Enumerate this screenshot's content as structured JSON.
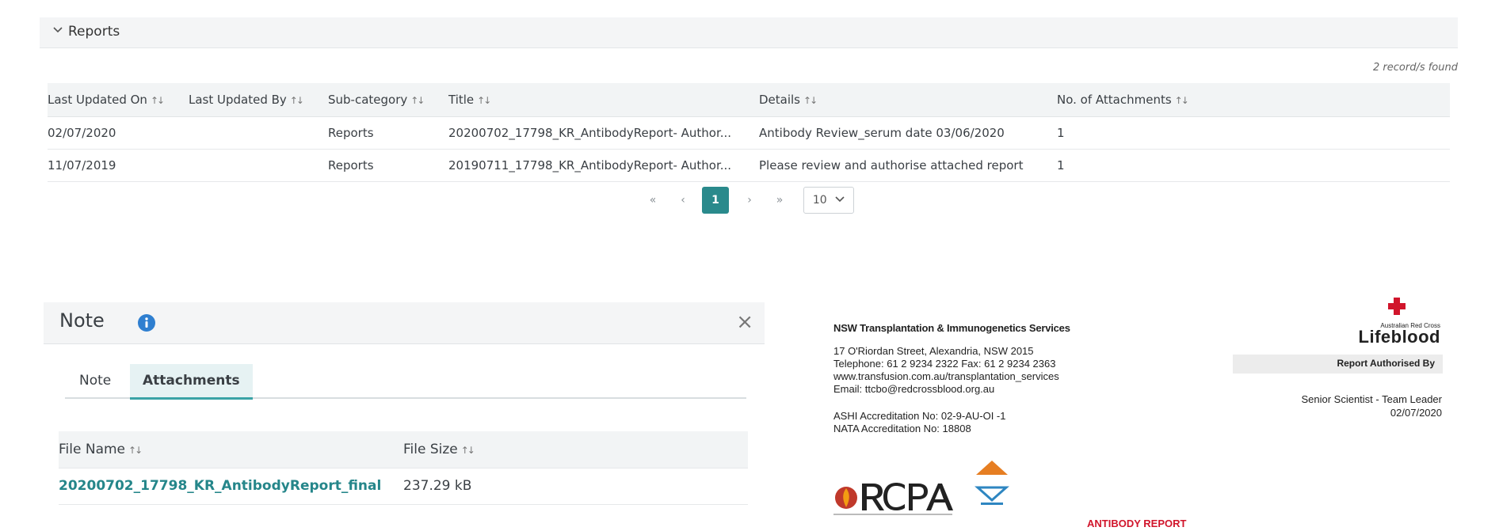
{
  "reports": {
    "section_title": "Reports",
    "records_found": "2 record/s found",
    "columns": [
      "Last Updated On",
      "Last Updated By",
      "Sub-category",
      "Title",
      "Details",
      "No. of Attachments"
    ],
    "sort_glyph": "↑↓",
    "rows": [
      {
        "updated_on": "02/07/2020",
        "updated_by": "",
        "subcategory": "Reports",
        "title": "20200702_17798_KR_AntibodyReport- Author...",
        "details": "Antibody Review_serum date 03/06/2020",
        "attachments": "1"
      },
      {
        "updated_on": "11/07/2019",
        "updated_by": "",
        "subcategory": "Reports",
        "title": "20190711_17798_KR_AntibodyReport- Author...",
        "details": "Please review and authorise attached report",
        "attachments": "1"
      }
    ],
    "pagination": {
      "first": "«",
      "prev": "‹",
      "current": "1",
      "next": "›",
      "last": "»",
      "page_size": "10"
    }
  },
  "note": {
    "title": "Note",
    "close": "×",
    "tabs": [
      "Note",
      "Attachments"
    ],
    "active_tab": "Attachments",
    "columns": [
      "File Name",
      "File Size"
    ],
    "files": [
      {
        "name": "20200702_17798_KR_AntibodyReport_final",
        "size": "237.29 kB"
      }
    ]
  },
  "document": {
    "org_name": "NSW Transplantation & Immunogenetics Services",
    "address_lines": [
      "17 O'Riordan Street, Alexandria, NSW 2015",
      "Telephone: 61 2 9234 2322 Fax: 61 2 9234 2363",
      "www.transfusion.com.au/transplantation_services",
      "Email: ttcbo@redcrossblood.org.au"
    ],
    "accreditation_lines": [
      "ASHI Accreditation No: 02-9-AU-OI -1",
      "NATA Accreditation No: 18808"
    ],
    "brand_small": "Australian Red Cross",
    "brand": "Lifeblood",
    "authorised_label": "Report Authorised By",
    "authoriser_role": "Senior Scientist - Team Leader",
    "authorised_date": "02/07/2020",
    "report_title": "ANTIBODY REPORT"
  },
  "colors": {
    "accent": "#2a8a8c",
    "link": "#25868a",
    "info": "#2f7fd0",
    "brand_red": "#d1152b"
  }
}
